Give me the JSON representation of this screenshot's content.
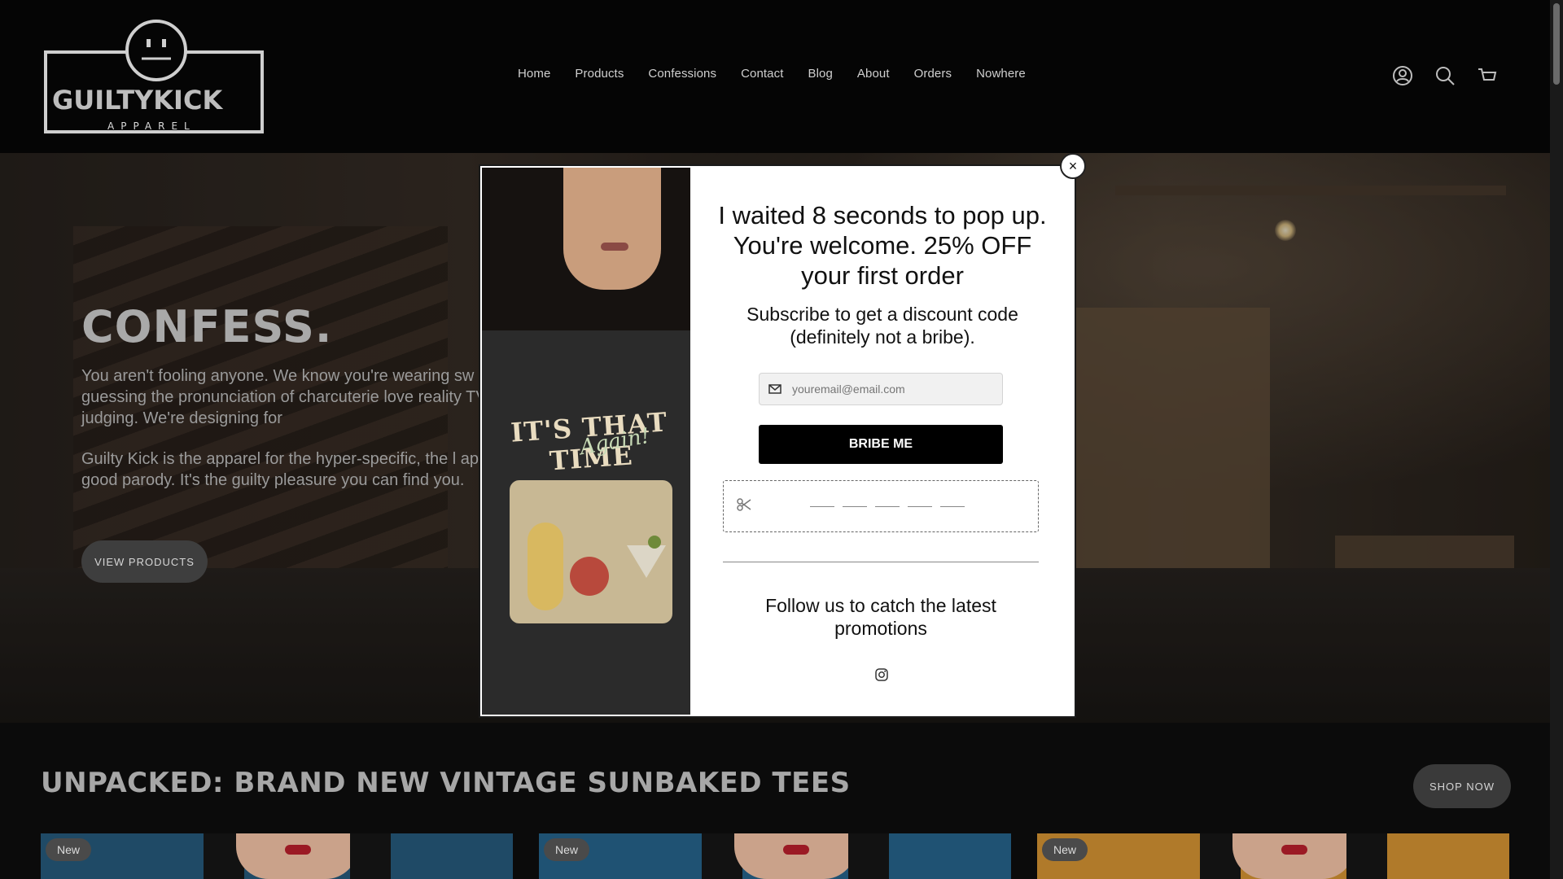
{
  "header": {
    "logo_text": "GUILTYKICK",
    "logo_sub": "APPAREL",
    "nav": [
      "Home",
      "Products",
      "Confessions",
      "Contact",
      "Blog",
      "About",
      "Orders",
      "Nowhere"
    ],
    "icons": [
      "account-icon",
      "search-icon",
      "cart-icon"
    ]
  },
  "hero": {
    "title": "CONFESS.",
    "p1": "You aren't fooling anyone. We know you're wearing sw you're just guessing the pronunciation of charcuterie love reality TV. We aren't judging. We're designing for",
    "p2": "Guilty Kick is the apparel for the hyper-specific, the l appreciate a good parody. It's the guilty pleasure you can find you.",
    "button": "VIEW PRODUCTS"
  },
  "section": {
    "title": "UNPACKED: BRAND NEW VINTAGE SUNBAKED TEES",
    "button": "SHOP NOW",
    "cards": [
      {
        "badge": "New",
        "bg": "#1f4a66"
      },
      {
        "badge": "New",
        "bg": "#1f5273"
      },
      {
        "badge": "New",
        "bg": "#b07a2a"
      }
    ]
  },
  "modal": {
    "close": "×",
    "heading": "I waited 8 seconds to pop up. You're welcome. 25% OFF your first order",
    "subtitle": "Subscribe to get a discount code (definitely not a bribe).",
    "email_placeholder": "youremail@email.com",
    "email_value": "",
    "submit": "BRIBE ME",
    "follow": "Follow us to catch the latest promotions",
    "shirt_line1": "IT'S THAT TIME",
    "shirt_line2": "Again!",
    "icons": [
      "mail-icon",
      "scissors-icon",
      "instagram-icon",
      "close-icon"
    ]
  },
  "colors": {
    "page_bg": "#0b0b0b",
    "header_bg": "#050505",
    "modal_bg": "#ffffff",
    "cta_bg": "#000000"
  }
}
